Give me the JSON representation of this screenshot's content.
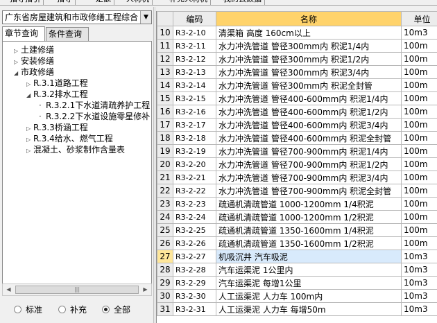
{
  "top_tabs": [
    {
      "label": "指导指引"
    },
    {
      "label": "指导"
    },
    {
      "label": "定额"
    },
    {
      "label": "人材机"
    },
    {
      "label": "补充人材机"
    },
    {
      "label": "我的云数据"
    }
  ],
  "library": {
    "selected": "广东省房屋建筑和市政修缮工程综合"
  },
  "tabs": [
    {
      "label": "章节查询",
      "active": true
    },
    {
      "label": "条件查询",
      "active": false
    }
  ],
  "tree": [
    {
      "label": "土建修缮",
      "toggle": "▷",
      "level": 0
    },
    {
      "label": "安装修缮",
      "toggle": "▷",
      "level": 0
    },
    {
      "label": "市政修缮",
      "toggle": "◢",
      "level": 0
    },
    {
      "label": "R.3.1道路工程",
      "toggle": "▷",
      "level": 1
    },
    {
      "label": "R.3.2排水工程",
      "toggle": "◢",
      "level": 1
    },
    {
      "label": "R.3.2.1下水道清疏养护工程",
      "toggle": "",
      "level": 2
    },
    {
      "label": "R.3.2.2下水道设施零星修补",
      "toggle": "",
      "level": 2
    },
    {
      "label": "R.3.3桥涵工程",
      "toggle": "▷",
      "level": 1
    },
    {
      "label": "R.3.4给水、燃气工程",
      "toggle": "▷",
      "level": 1
    },
    {
      "label": "混凝土、砂浆制作含量表",
      "toggle": "▷",
      "level": 1
    }
  ],
  "filter": {
    "options": [
      {
        "label": "标准",
        "checked": false
      },
      {
        "label": "补充",
        "checked": false
      },
      {
        "label": "全部",
        "checked": true
      }
    ]
  },
  "grid": {
    "headers": {
      "code": "编码",
      "name": "名称",
      "unit": "单位"
    },
    "rows": [
      {
        "no": "10",
        "code": "R3-2-10",
        "name": "清渠箱 高度 160cm以上",
        "unit": "10m3"
      },
      {
        "no": "11",
        "code": "R3-2-11",
        "name": "水力冲洗管道 管径300mm内 积泥1/4内",
        "unit": "100m"
      },
      {
        "no": "12",
        "code": "R3-2-12",
        "name": "水力冲洗管道 管径300mm内 积泥1/2内",
        "unit": "100m"
      },
      {
        "no": "13",
        "code": "R3-2-13",
        "name": "水力冲洗管道 管径300mm内 积泥3/4内",
        "unit": "100m"
      },
      {
        "no": "14",
        "code": "R3-2-14",
        "name": "水力冲洗管道 管径300mm内 积泥全封管",
        "unit": "100m"
      },
      {
        "no": "15",
        "code": "R3-2-15",
        "name": "水力冲洗管道 管径400-600mm内 积泥1/4内",
        "unit": "100m"
      },
      {
        "no": "16",
        "code": "R3-2-16",
        "name": "水力冲洗管道 管径400-600mm内 积泥1/2内",
        "unit": "100m"
      },
      {
        "no": "17",
        "code": "R3-2-17",
        "name": "水力冲洗管道 管径400-600mm内 积泥3/4内",
        "unit": "100m"
      },
      {
        "no": "18",
        "code": "R3-2-18",
        "name": "水力冲洗管道 管径400-600mm内 积泥全封管",
        "unit": "100m"
      },
      {
        "no": "19",
        "code": "R3-2-19",
        "name": "水力冲洗管道 管径700-900mm内 积泥1/4内",
        "unit": "100m"
      },
      {
        "no": "20",
        "code": "R3-2-20",
        "name": "水力冲洗管道 管径700-900mm内 积泥1/2内",
        "unit": "100m"
      },
      {
        "no": "21",
        "code": "R3-2-21",
        "name": "水力冲洗管道 管径700-900mm内 积泥3/4内",
        "unit": "100m"
      },
      {
        "no": "22",
        "code": "R3-2-22",
        "name": "水力冲洗管道 管径700-900mm内 积泥全封管",
        "unit": "100m"
      },
      {
        "no": "23",
        "code": "R3-2-23",
        "name": "疏通机清疏管道 1000-1200mm 1/4积泥",
        "unit": "100m"
      },
      {
        "no": "24",
        "code": "R3-2-24",
        "name": "疏通机清疏管道 1000-1200mm 1/2积泥",
        "unit": "100m"
      },
      {
        "no": "25",
        "code": "R3-2-25",
        "name": "疏通机清疏管道 1350-1600mm 1/4积泥",
        "unit": "100m"
      },
      {
        "no": "26",
        "code": "R3-2-26",
        "name": "疏通机清疏管道 1350-1600mm 1/2积泥",
        "unit": "100m"
      },
      {
        "no": "27",
        "code": "R3-2-27",
        "name": "机吸沉井 汽车吸泥",
        "unit": "10m3",
        "selected": true
      },
      {
        "no": "28",
        "code": "R3-2-28",
        "name": "汽车运渠泥 1公里内",
        "unit": "10m3"
      },
      {
        "no": "29",
        "code": "R3-2-29",
        "name": "汽车运渠泥 每增1公里",
        "unit": "10m3"
      },
      {
        "no": "30",
        "code": "R3-2-30",
        "name": "人工运渠泥 人力车 100m内",
        "unit": "10m3"
      },
      {
        "no": "31",
        "code": "R3-2-31",
        "name": "人工运渠泥 人力车 每增50m",
        "unit": "10m3"
      }
    ]
  }
}
